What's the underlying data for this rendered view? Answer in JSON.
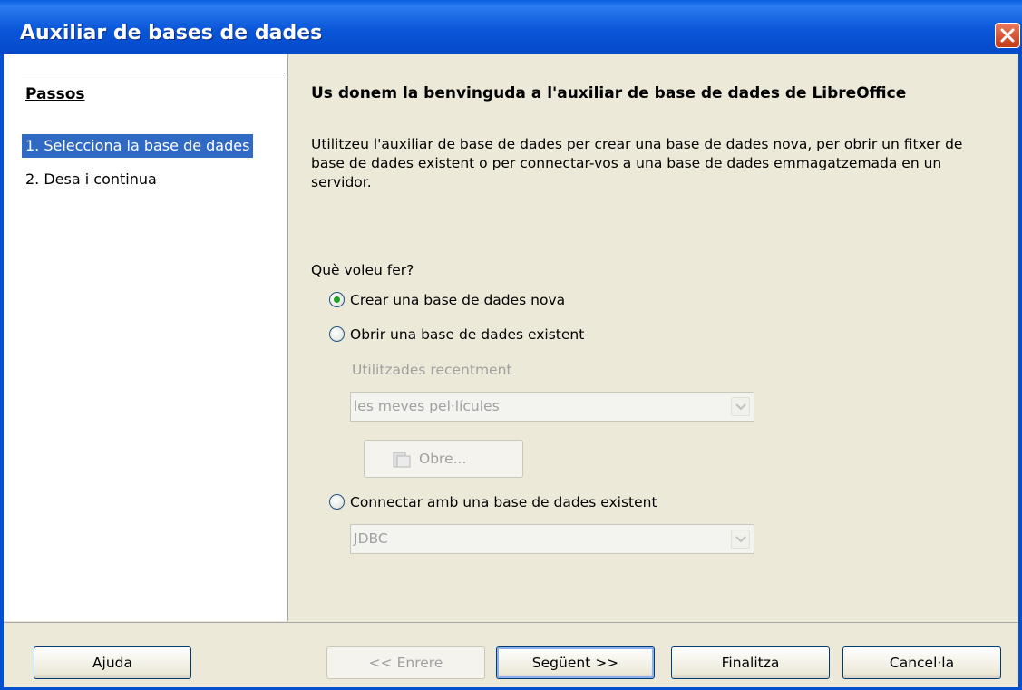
{
  "window": {
    "title": "Auxiliar de bases de dades",
    "close_icon": "close-icon"
  },
  "sidebar": {
    "title": "Passos",
    "steps": [
      {
        "label": "1. Selecciona la base de dades",
        "active": true
      },
      {
        "label": "2. Desa i continua",
        "active": false
      }
    ]
  },
  "main": {
    "heading": "Us donem la benvinguda a l'auxiliar de base de dades de LibreOffice",
    "intro": "Utilitzeu l'auxiliar de base de dades per crear una base de dades nova, per obrir un fitxer de base de dades existent o per connectar-vos a una base de dades emmagatzemada en un servidor.",
    "question": "Què voleu fer?",
    "options": [
      {
        "label": "Crear una base de dades nova",
        "selected": true
      },
      {
        "label": "Obrir una base de dades existent",
        "selected": false
      },
      {
        "label": "Connectar amb una base de dades existent",
        "selected": false
      }
    ],
    "recent_label": "Utilitzades recentment",
    "recent_value": "les meves pel·lícules",
    "open_button": "Obre...",
    "connection_value": "JDBC"
  },
  "buttons": {
    "help": "Ajuda",
    "back": "<< Enrere",
    "next": "Següent >>",
    "finish": "Finalitza",
    "cancel": "Cancel·la"
  },
  "colors": {
    "titlebar": "#0a56d8",
    "selection": "#316ac5",
    "dialog_bg": "#ece9d8"
  }
}
